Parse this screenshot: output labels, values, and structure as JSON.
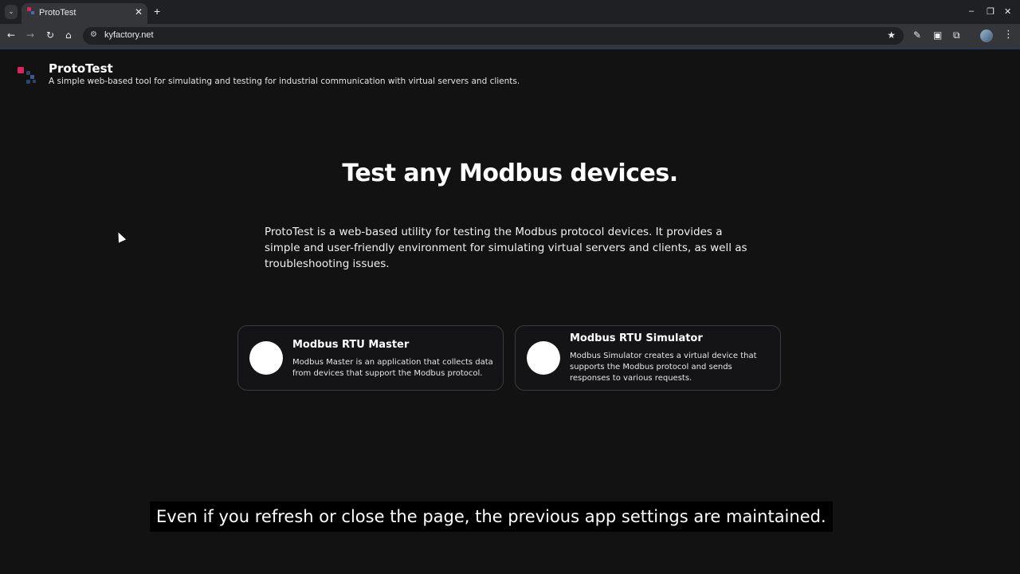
{
  "browser": {
    "tab_title": "ProtoTest",
    "tab_close": "✕",
    "new_tab": "+",
    "url": "kyfactory.net",
    "window_controls": [
      "–",
      "❐",
      "✕"
    ]
  },
  "header": {
    "title": "ProtoTest",
    "subtitle": "A simple web-based tool for simulating and testing for industrial communication with virtual servers and clients."
  },
  "hero": {
    "title": "Test any Modbus devices.",
    "description": "ProtoTest is a web-based utility for testing the Modbus protocol devices. It provides a simple and user-friendly environment for simulating virtual servers and clients, as well as troubleshooting issues."
  },
  "cards": [
    {
      "title": "Modbus RTU Master",
      "text": "Modbus Master is an application that collects data from devices that support the Modbus protocol."
    },
    {
      "title": "Modbus RTU Simulator",
      "text": "Modbus Simulator creates a virtual device that supports the Modbus protocol and sends responses to various requests."
    }
  ],
  "caption": "Even if you refresh or close the page, the previous app settings are maintained."
}
